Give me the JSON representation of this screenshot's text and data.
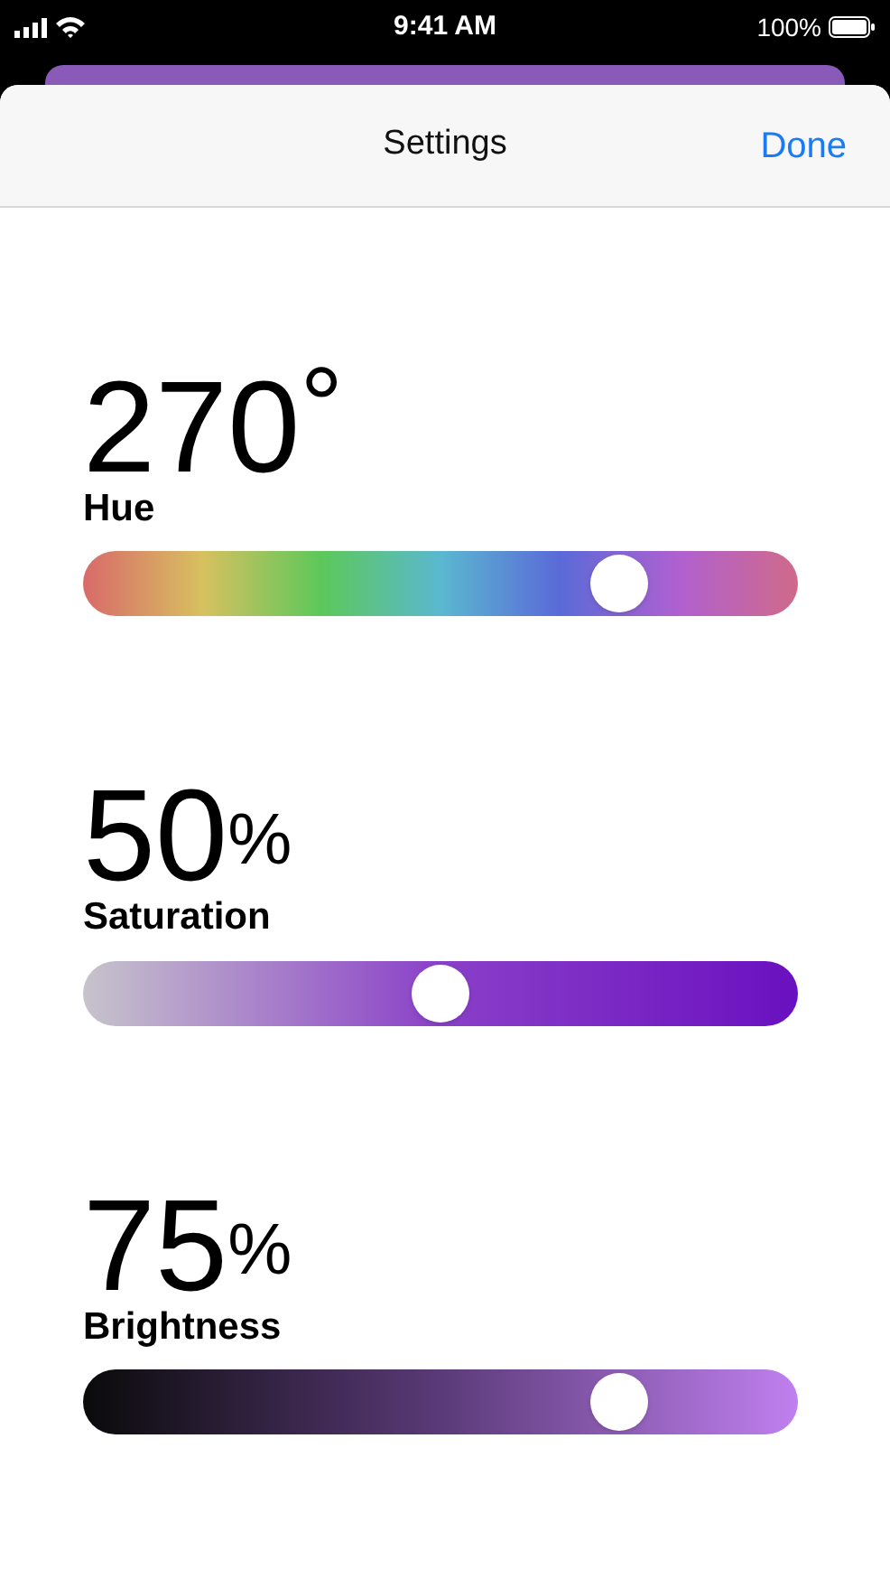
{
  "status_bar": {
    "time": "9:41 AM",
    "battery": "100%"
  },
  "header": {
    "title": "Settings",
    "done": "Done"
  },
  "sliders": [
    {
      "kind": "hue",
      "value": "270",
      "unit": "°",
      "label": "Hue",
      "level": 0.75
    },
    {
      "kind": "saturation",
      "value": "50",
      "unit": "%",
      "label": "Saturation",
      "level": 0.5
    },
    {
      "kind": "brightness",
      "value": "75",
      "unit": "%",
      "label": "Brightness",
      "level": 0.75
    }
  ]
}
